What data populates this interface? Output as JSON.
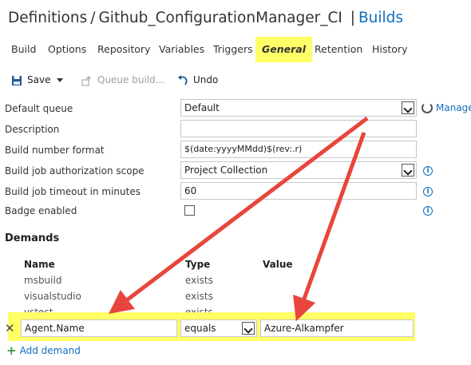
{
  "header": {
    "definitions": "Definitions",
    "separator": "/",
    "definition_name": "Github_ConfigurationManager_CI",
    "pipe": "|",
    "builds_link": "Builds"
  },
  "tabs": [
    {
      "label": "Build"
    },
    {
      "label": "Options"
    },
    {
      "label": "Repository"
    },
    {
      "label": "Variables"
    },
    {
      "label": "Triggers"
    },
    {
      "label": "General",
      "active": true
    },
    {
      "label": "Retention"
    },
    {
      "label": "History"
    }
  ],
  "toolbar": {
    "save_label": "Save",
    "queue_build_label": "Queue build...",
    "undo_label": "Undo"
  },
  "form": {
    "default_queue": {
      "label": "Default queue",
      "value": "Default",
      "manage": "Manage"
    },
    "description": {
      "label": "Description",
      "value": ""
    },
    "build_number_format": {
      "label": "Build number format",
      "value": "$(date:yyyyMMdd)$(rev:.r)"
    },
    "auth_scope": {
      "label": "Build job authorization scope",
      "value": "Project Collection"
    },
    "timeout": {
      "label": "Build job timeout in minutes",
      "value": "60"
    },
    "badge": {
      "label": "Badge enabled",
      "checked": false
    }
  },
  "demands": {
    "title": "Demands",
    "columns": {
      "name": "Name",
      "type": "Type",
      "value": "Value"
    },
    "rows": [
      {
        "name": "msbuild",
        "type": "exists"
      },
      {
        "name": "visualstudio",
        "type": "exists"
      },
      {
        "name": "vstest",
        "type": "exists"
      }
    ],
    "new_row": {
      "name": "Agent.Name",
      "type": "equals",
      "value": "Azure-Alkampfer"
    },
    "add_label": "Add demand"
  },
  "colors": {
    "accent": "#106ebe",
    "highlight": "#ffff66",
    "arrow": "#e8453c"
  }
}
